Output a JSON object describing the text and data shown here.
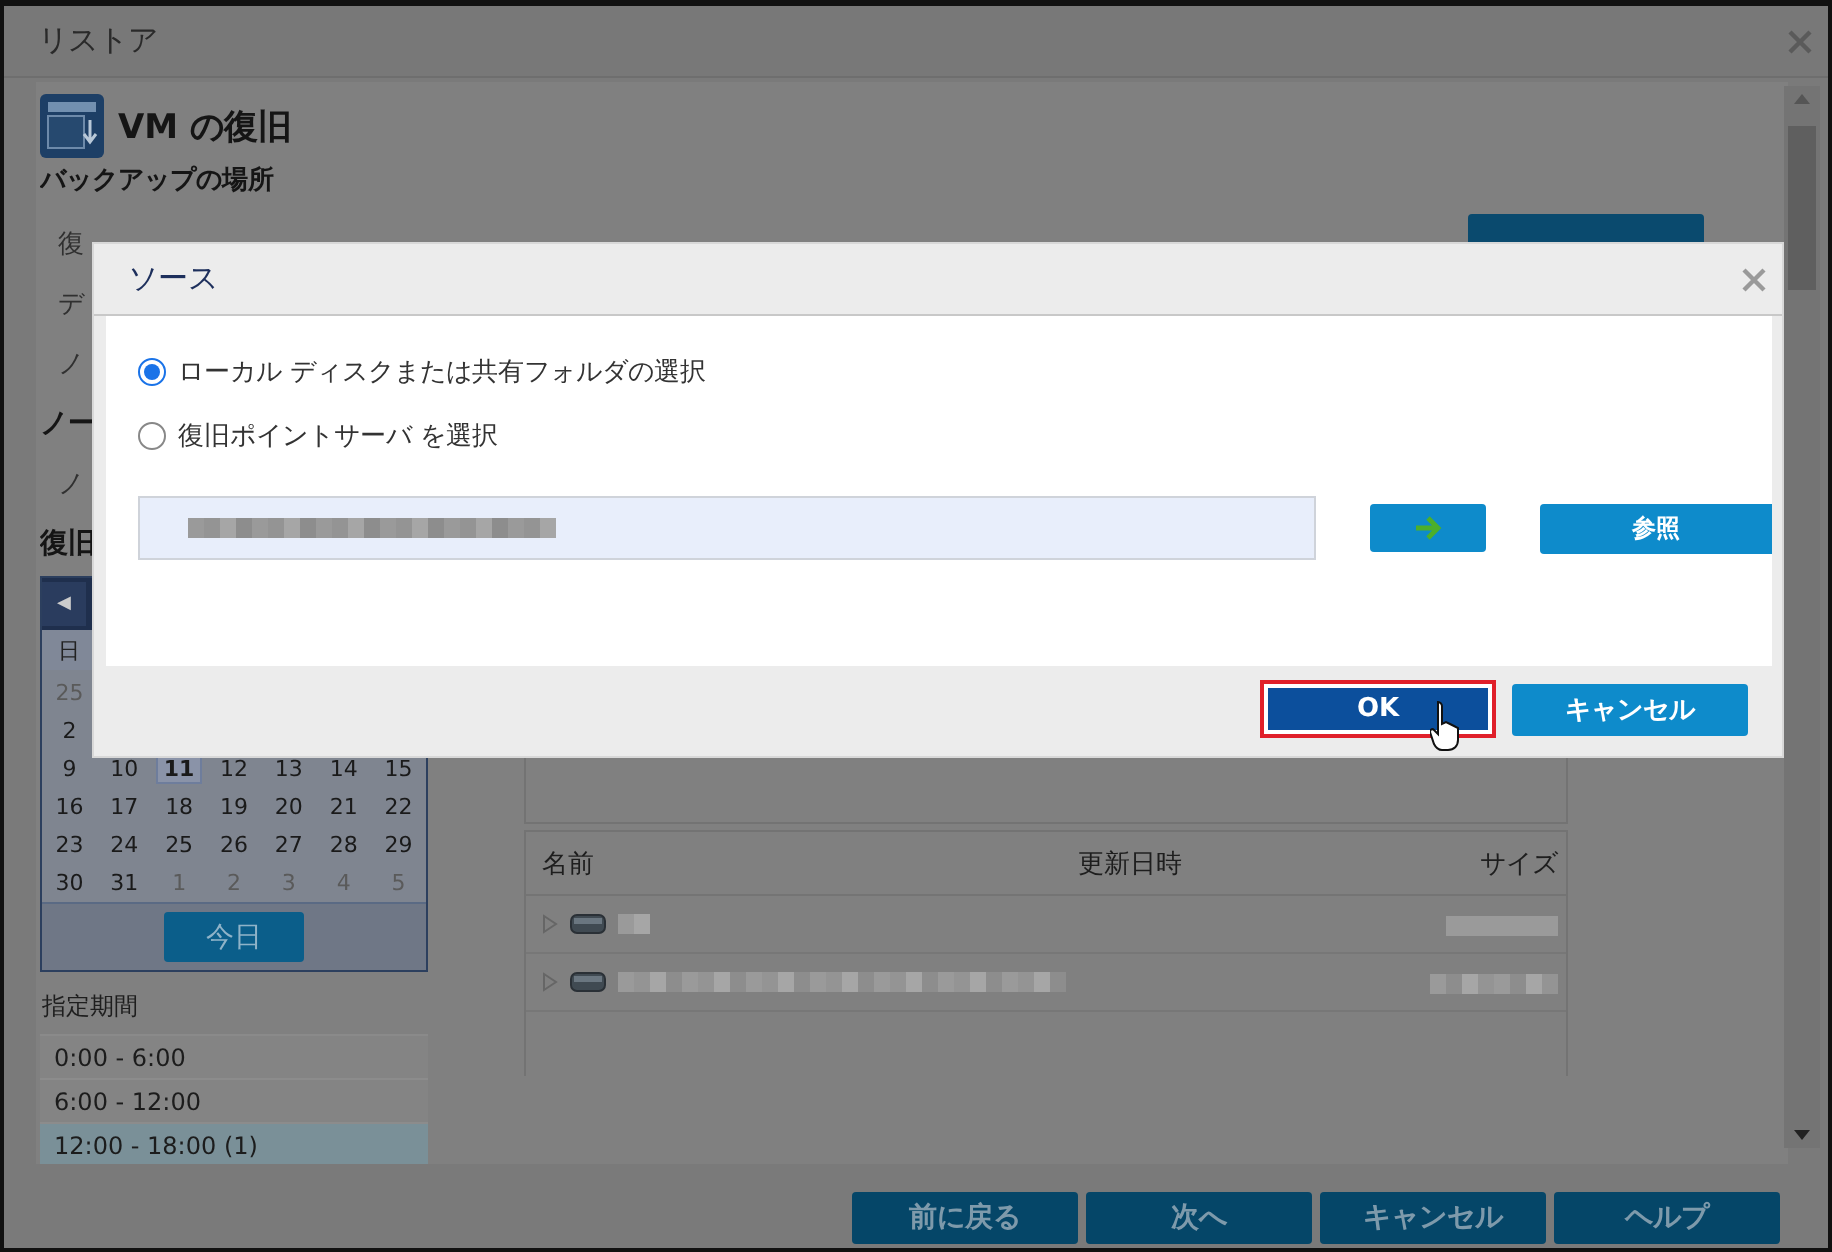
{
  "window": {
    "title": "リストア"
  },
  "page": {
    "heading": "VM の復旧",
    "section": "バックアップの場所"
  },
  "left_labels": [
    {
      "text": "復",
      "kind": "label"
    },
    {
      "text": "デ",
      "kind": "label"
    },
    {
      "text": "ノ",
      "kind": "label"
    },
    {
      "text": "ノー",
      "kind": "heading"
    },
    {
      "text": "ノ",
      "kind": "label"
    },
    {
      "text": "復旧",
      "kind": "heading"
    }
  ],
  "calendar": {
    "prev": "◀",
    "weekdays": [
      "日"
    ],
    "today_button": "今日",
    "weeks": [
      [
        {
          "day": "25",
          "muted": true,
          "selected": false
        }
      ],
      [
        {
          "day": "2",
          "muted": false,
          "selected": false
        }
      ],
      [
        {
          "day": "9",
          "muted": false,
          "selected": false
        },
        {
          "day": "10",
          "muted": false,
          "selected": false
        },
        {
          "day": "11",
          "muted": false,
          "selected": true
        },
        {
          "day": "12",
          "muted": false,
          "selected": false
        },
        {
          "day": "13",
          "muted": false,
          "selected": false
        },
        {
          "day": "14",
          "muted": false,
          "selected": false
        },
        {
          "day": "15",
          "muted": false,
          "selected": false
        }
      ],
      [
        {
          "day": "16",
          "muted": false,
          "selected": false
        },
        {
          "day": "17",
          "muted": false,
          "selected": false
        },
        {
          "day": "18",
          "muted": false,
          "selected": false
        },
        {
          "day": "19",
          "muted": false,
          "selected": false
        },
        {
          "day": "20",
          "muted": false,
          "selected": false
        },
        {
          "day": "21",
          "muted": false,
          "selected": false
        },
        {
          "day": "22",
          "muted": false,
          "selected": false
        }
      ],
      [
        {
          "day": "23",
          "muted": false,
          "selected": false
        },
        {
          "day": "24",
          "muted": false,
          "selected": false
        },
        {
          "day": "25",
          "muted": false,
          "selected": false
        },
        {
          "day": "26",
          "muted": false,
          "selected": false
        },
        {
          "day": "27",
          "muted": false,
          "selected": false
        },
        {
          "day": "28",
          "muted": false,
          "selected": false
        },
        {
          "day": "29",
          "muted": false,
          "selected": false
        }
      ],
      [
        {
          "day": "30",
          "muted": false,
          "selected": false
        },
        {
          "day": "31",
          "muted": false,
          "selected": false
        },
        {
          "day": "1",
          "muted": true,
          "selected": false
        },
        {
          "day": "2",
          "muted": true,
          "selected": false
        },
        {
          "day": "3",
          "muted": true,
          "selected": false
        },
        {
          "day": "4",
          "muted": true,
          "selected": false
        },
        {
          "day": "5",
          "muted": true,
          "selected": false
        }
      ]
    ]
  },
  "period": {
    "label": "指定期間",
    "items": [
      {
        "text": "0:00 - 6:00",
        "selected": false
      },
      {
        "text": "6:00 - 12:00",
        "selected": false
      },
      {
        "text": "12:00 - 18:00 (1)",
        "selected": true
      }
    ]
  },
  "files": {
    "columns": [
      "名前",
      "更新日時",
      "サイズ"
    ],
    "rows": [
      {
        "expanded": false
      },
      {
        "expanded": false
      }
    ]
  },
  "nav_buttons": [
    "前に戻る",
    "次へ",
    "キャンセル",
    "ヘルプ"
  ],
  "dialog": {
    "title": "ソース",
    "options": [
      {
        "label": "ローカル ディスクまたは共有フォルダの選択",
        "selected": true
      },
      {
        "label": "復旧ポイントサーバ を選択",
        "selected": false
      }
    ],
    "browse_button": "参照",
    "ok_button": "OK",
    "cancel_button": "キャンセル",
    "ok_focused": true
  }
}
